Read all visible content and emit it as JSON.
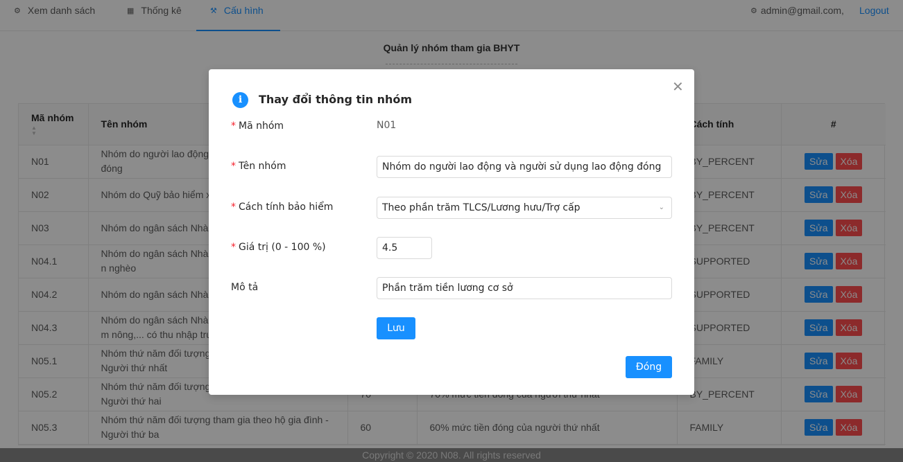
{
  "nav": {
    "items": [
      {
        "label": "Xem danh sách",
        "icon": "team-icon"
      },
      {
        "label": "Thống kê",
        "icon": "bar-chart-icon"
      },
      {
        "label": "Cấu hình",
        "icon": "tool-icon"
      }
    ],
    "user": "admin@gmail.com,",
    "logout": "Logout"
  },
  "page": {
    "title": "Quản lý nhóm tham gia BHYT"
  },
  "table": {
    "headers": [
      "Mã nhóm",
      "Tên nhóm",
      "",
      "",
      "Cách tính",
      "#"
    ],
    "edit_label": "Sửa",
    "delete_label": "Xóa",
    "rows": [
      {
        "code": "N01",
        "name": "Nhóm do người lao động",
        "name2": "đóng",
        "c3": "",
        "c4": "",
        "method": "BY_PERCENT"
      },
      {
        "code": "N02",
        "name": "Nhóm do Quỹ bảo hiểm x",
        "name2": "",
        "c3": "",
        "c4": "",
        "method": "BY_PERCENT"
      },
      {
        "code": "N03",
        "name": "Nhóm do ngân sách Nhà",
        "name2": "",
        "c3": "",
        "c4": "",
        "method": "BY_PERCENT"
      },
      {
        "code": "N04.1",
        "name": "Nhóm do ngân sách Nhà",
        "name2": "n nghèo",
        "c3": "",
        "c4": "",
        "method": "SUPPORTED"
      },
      {
        "code": "N04.2",
        "name": "Nhóm do ngân sách Nhà",
        "name2": "",
        "c3": "",
        "c4": "",
        "method": "SUPPORTED"
      },
      {
        "code": "N04.3",
        "name": "Nhóm do ngân sách Nhà",
        "name2": "m nông,... có thu nhập tru",
        "c3": "",
        "c4": "",
        "method": "SUPPORTED"
      },
      {
        "code": "N05.1",
        "name": "Nhóm thứ năm đối tượng",
        "name2": "Người thứ nhất",
        "c3": "",
        "c4": "",
        "method": "FAMILY"
      },
      {
        "code": "N05.2",
        "name": "Nhóm thứ năm đối tượng",
        "name2": "Người thứ hai",
        "c3": "70",
        "c4": "70% mức tiền đóng của người thứ nhất",
        "method": "BY_PERCENT"
      },
      {
        "code": "N05.3",
        "name": "Nhóm thứ năm đối tượng tham gia theo hộ gia đình -",
        "name2": "Người thứ ba",
        "c3": "60",
        "c4": "60% mức tiền đóng của người thứ nhất",
        "method": "FAMILY"
      }
    ]
  },
  "footer": "Copyright © 2020 N08. All rights reserved",
  "modal": {
    "title": "Thay đổi thông tin nhóm",
    "fields": {
      "code_label": "Mã nhóm",
      "code_value": "N01",
      "name_label": "Tên nhóm",
      "name_value": "Nhóm do người lao động và người sử dụng lao động đóng",
      "method_label": "Cách tính bảo hiểm",
      "method_value": "Theo phần trăm TLCS/Lương hưu/Trợ cấp",
      "value_label": "Giá trị (0 - 100 %)",
      "value_value": "4.5",
      "desc_label": "Mô tả",
      "desc_value": "Phần trăm tiền lương cơ sở"
    },
    "save_label": "Lưu",
    "close_label": "Đóng"
  },
  "colors": {
    "primary": "#1890ff",
    "danger": "#ff4d4f",
    "required": "#f5222d"
  }
}
